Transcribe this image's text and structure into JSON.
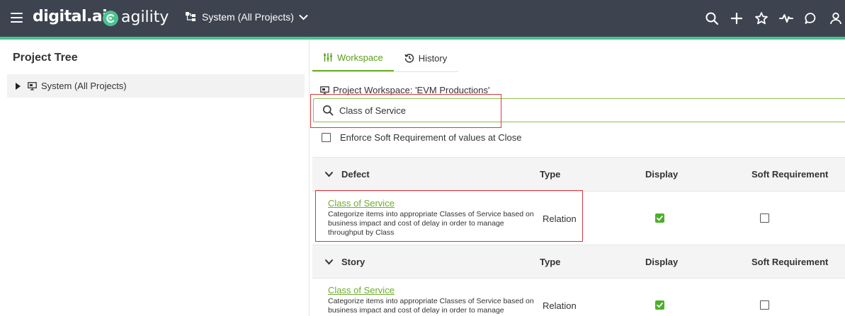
{
  "topbar": {
    "brand": "digital.ai",
    "product": "agility",
    "project_selector": "System (All Projects)",
    "colors": {
      "bg": "#3d4450",
      "accent": "#4cc28f"
    },
    "icons": [
      "search-icon",
      "plus-icon",
      "star-icon",
      "activity-icon",
      "chat-icon",
      "user-icon"
    ]
  },
  "left_panel": {
    "title": "Project Tree",
    "tree_items": [
      {
        "label": "System (All Projects)"
      }
    ]
  },
  "tabs": [
    {
      "label": "Workspace",
      "active": true
    },
    {
      "label": "History",
      "active": false
    }
  ],
  "workspace": {
    "label": "Project Workspace: 'EVM Productions'",
    "search_value": "Class of Service",
    "enforce_label": "Enforce Soft Requirement of values at Close",
    "enforce_checked": false
  },
  "columns": {
    "type": "Type",
    "display": "Display",
    "soft": "Soft Requirement"
  },
  "sections": [
    {
      "name": "Defect",
      "rows": [
        {
          "name": "Class of Service",
          "description": "Categorize items into appropriate Classes of Service based on business impact and cost of delay in order to manage throughput by Class",
          "type": "Relation",
          "display": true,
          "soft_requirement": false
        }
      ]
    },
    {
      "name": "Story",
      "rows": [
        {
          "name": "Class of Service",
          "description": "Categorize items into appropriate Classes of Service based on business impact and cost of delay in order to manage throughput by Class",
          "type": "Relation",
          "display": true,
          "soft_requirement": false
        }
      ]
    }
  ],
  "colors": {
    "link_green": "#6cae2a",
    "check_green": "#4caf2c",
    "highlight_red": "#d9363e"
  }
}
